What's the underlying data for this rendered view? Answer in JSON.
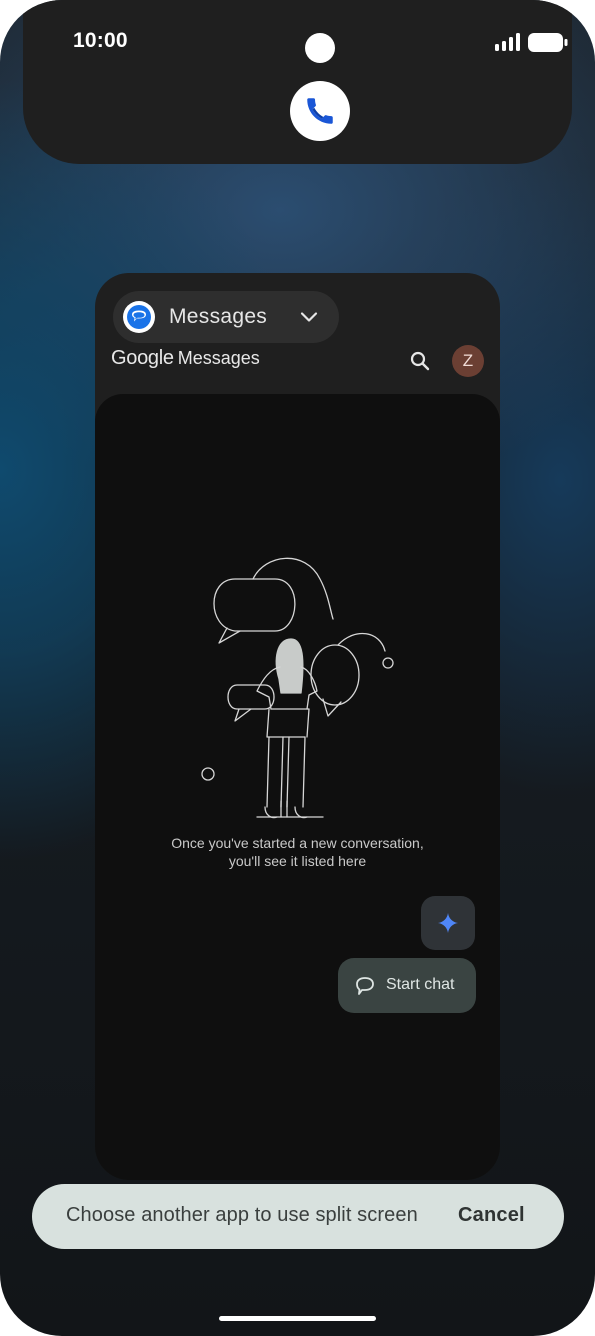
{
  "status_bar": {
    "time": "10:00",
    "signal_icon": "cellular-signal-icon",
    "battery_icon": "battery-full-icon"
  },
  "top_pill": {
    "app_icon": "phone-app-icon",
    "app_icon_color": "#1a56d6"
  },
  "app_card": {
    "chip_label": "Messages",
    "chip_icon": "messages-app-icon",
    "chip_chevron": "chevron-down-icon",
    "brand_google": "Google",
    "brand_messages": "Messages",
    "search_icon": "search-icon",
    "avatar_initial": "Z",
    "empty_state": {
      "line1": "Once you've started a new conversation,",
      "line2": "you'll see it listed here"
    },
    "gemini_icon": "gemini-sparkle-icon",
    "start_chat_label": "Start chat",
    "start_chat_icon": "chat-bubble-icon"
  },
  "split_toast": {
    "message": "Choose another app to use split screen",
    "cancel_label": "Cancel"
  },
  "colors": {
    "accent_blue": "#4f86f7",
    "toast_bg": "#d8e1de",
    "card_bg": "#1f1f1f",
    "avatar_bg": "#6b3f33"
  }
}
